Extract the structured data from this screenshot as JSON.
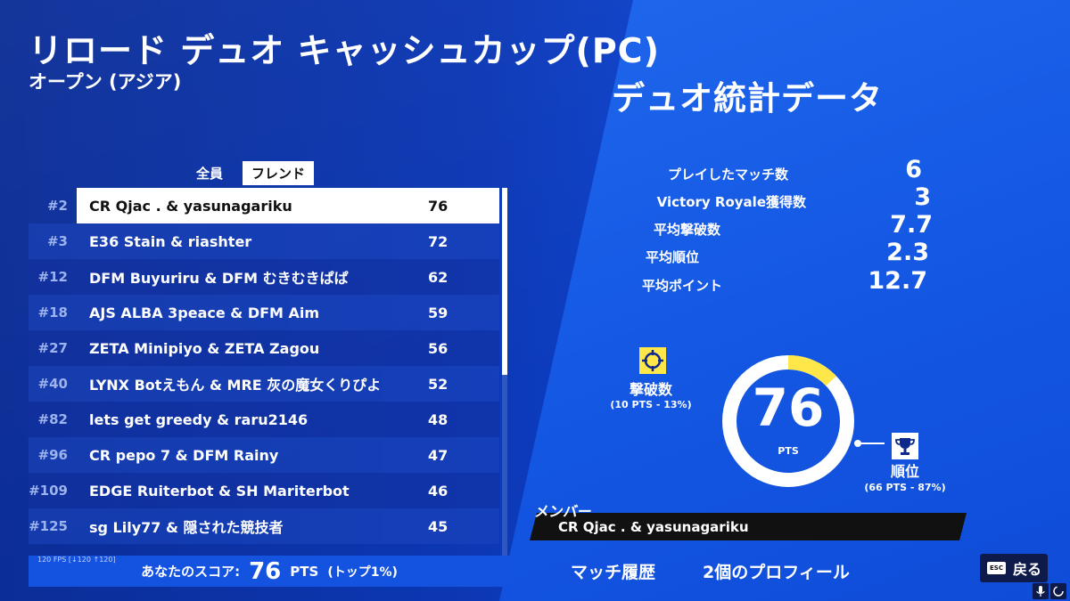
{
  "header": {
    "title": "リロード デュオ キャッシュカップ(PC)",
    "subtitle": "オープン (アジア)",
    "stats_heading": "デュオ統計データ"
  },
  "tabs": [
    {
      "label": "全員",
      "active": false
    },
    {
      "label": "フレンド",
      "active": true
    }
  ],
  "leaderboard": [
    {
      "rank": "#2",
      "name": "CR Qjac . & yasunagariku",
      "points": "76",
      "highlight": true
    },
    {
      "rank": "#3",
      "name": "E36 Stain & riashter",
      "points": "72"
    },
    {
      "rank": "#12",
      "name": "DFM Buyuriru & DFM むきむきぱぱ",
      "points": "62"
    },
    {
      "rank": "#18",
      "name": "AJS ALBA 3peace & DFM Aim",
      "points": "59"
    },
    {
      "rank": "#27",
      "name": "ZETA Minipiyo & ZETA Zagou",
      "points": "56"
    },
    {
      "rank": "#40",
      "name": "LYNX Botえもん & MRE 灰の魔女くりぴよ",
      "points": "52"
    },
    {
      "rank": "#82",
      "name": "lets get greedy & raru2146",
      "points": "48"
    },
    {
      "rank": "#96",
      "name": "CR pepo 7 & DFM Rainy",
      "points": "47"
    },
    {
      "rank": "#109",
      "name": "EDGE Ruiterbot & SH Mariterbot",
      "points": "46"
    },
    {
      "rank": "#125",
      "name": "sg Lily77 & 隠された競技者",
      "points": "45"
    }
  ],
  "fps": "120 FPS [↓120 ↑120]",
  "score": {
    "label": "あなたのスコア:",
    "value": "76",
    "unit": "PTS",
    "rank": "(トップ1%)"
  },
  "stats": [
    {
      "label": "プレイしたマッチ数",
      "value": "6"
    },
    {
      "label": "Victory Royale獲得数",
      "value": "3"
    },
    {
      "label": "平均撃破数",
      "value": "7.7"
    },
    {
      "label": "平均順位",
      "value": "2.3"
    },
    {
      "label": "平均ポイント",
      "value": "12.7"
    }
  ],
  "breakdown": {
    "total": "76",
    "total_unit": "PTS",
    "elim_label": "撃破数",
    "elim_sub": "(10 PTS - 13%)",
    "elim_fraction": 0.13,
    "place_label": "順位",
    "place_sub": "(66 PTS - 87%)",
    "place_fraction": 0.87,
    "colors": {
      "elim": "#ffe74a",
      "place": "#ffffff"
    }
  },
  "member": {
    "label": "メンバー",
    "name": "CR Qjac . & yasunagariku"
  },
  "bottom_tabs": [
    "マッチ履歴",
    "2個のプロフィール"
  ],
  "esc": {
    "key": "ESC",
    "label": "戻る"
  }
}
